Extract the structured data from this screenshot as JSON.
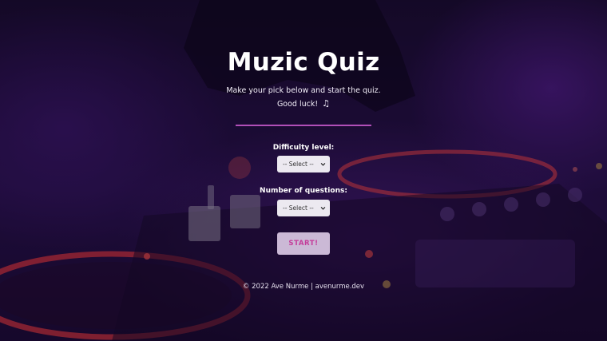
{
  "title": "Muzic Quiz",
  "subtitle": "Make your pick below and start the quiz.",
  "good_luck": "Good luck!",
  "note_icon": "♫",
  "difficulty": {
    "label": "Difficulty level:",
    "value": "-- Select --"
  },
  "questions": {
    "label": "Number of questions:",
    "value": "-- Select --"
  },
  "start_label": "START!",
  "footer": "© 2022  Ave Nurme | avenurme.dev",
  "colors": {
    "accent": "#b14fb8",
    "button_text": "#c43c9a",
    "button_bg": "#cbb9d6"
  }
}
